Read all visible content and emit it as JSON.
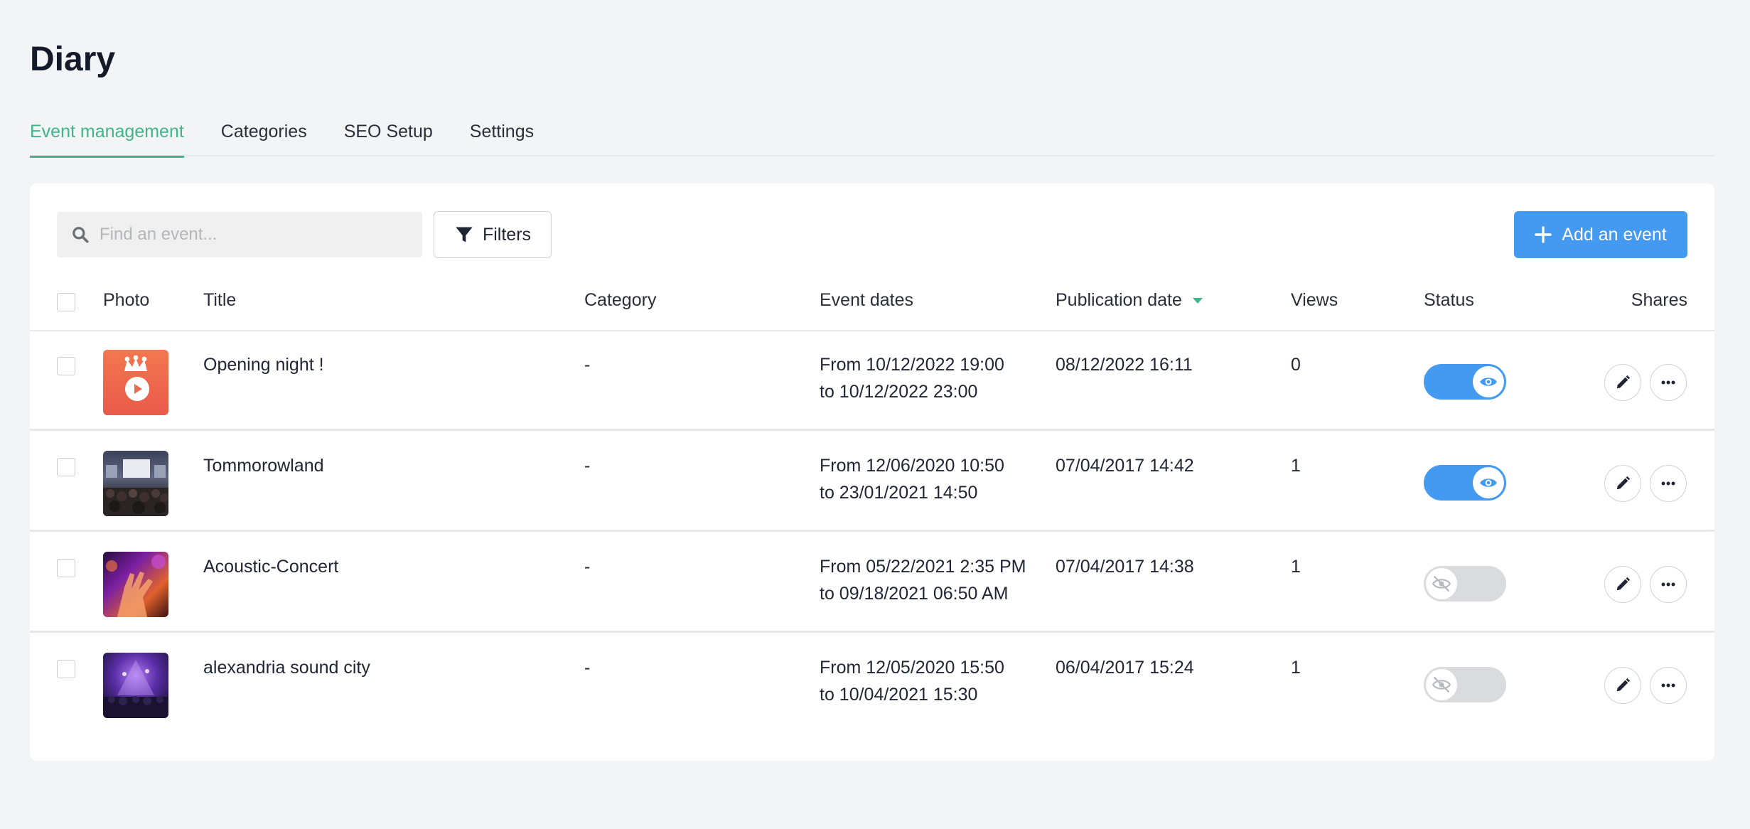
{
  "page": {
    "title": "Diary"
  },
  "tabs": [
    {
      "label": "Event management",
      "active": true
    },
    {
      "label": "Categories",
      "active": false
    },
    {
      "label": "SEO Setup",
      "active": false
    },
    {
      "label": "Settings",
      "active": false
    }
  ],
  "toolbar": {
    "search_placeholder": "Find an event...",
    "filters_label": "Filters",
    "add_label": "Add an event"
  },
  "table": {
    "headers": {
      "photo": "Photo",
      "title": "Title",
      "category": "Category",
      "event_dates": "Event dates",
      "publication_date": "Publication date",
      "views": "Views",
      "status": "Status",
      "shares": "Shares"
    },
    "sort": {
      "column": "publication_date",
      "direction": "desc"
    },
    "rows": [
      {
        "title": "Opening night !",
        "category": "-",
        "date_from": "From 10/12/2022 19:00",
        "date_to": "to 10/12/2022 23:00",
        "publication_date": "08/12/2022 16:11",
        "views": "0",
        "published": true,
        "thumb": "logo-icon"
      },
      {
        "title": "Tommorowland",
        "category": "-",
        "date_from": "From 12/06/2020 10:50",
        "date_to": "to 23/01/2021 14:50",
        "publication_date": "07/04/2017 14:42",
        "views": "1",
        "published": true,
        "thumb": "concert-photo"
      },
      {
        "title": "Acoustic-Concert",
        "category": "-",
        "date_from": "From 05/22/2021 2:35 PM",
        "date_to": "to 09/18/2021 06:50 AM",
        "publication_date": "07/04/2017 14:38",
        "views": "1",
        "published": false,
        "thumb": "hand-photo"
      },
      {
        "title": "alexandria sound city",
        "category": "-",
        "date_from": "From 12/05/2020 15:50",
        "date_to": "to 10/04/2021 15:30",
        "publication_date": "06/04/2017 15:24",
        "views": "1",
        "published": false,
        "thumb": "crowd-photo"
      }
    ]
  },
  "colors": {
    "accent": "#3fb588",
    "primary": "#4499f0",
    "background": "#f3f4f6"
  }
}
